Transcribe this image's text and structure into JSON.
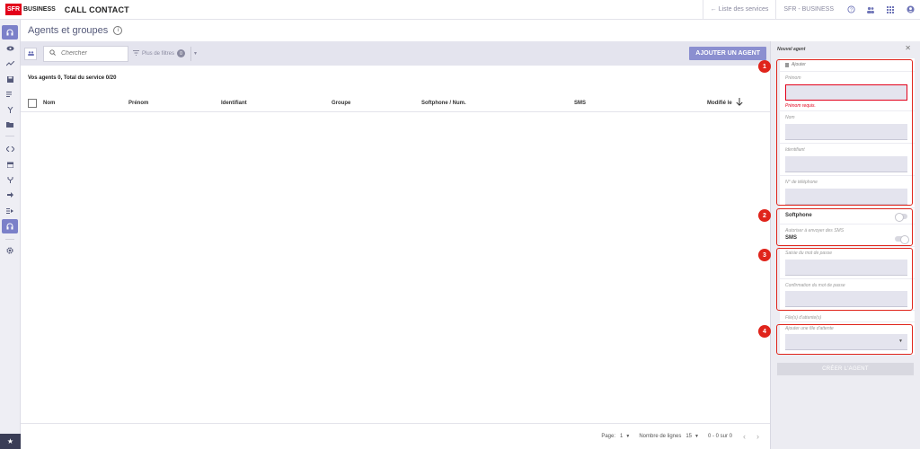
{
  "header": {
    "logo_sfr": "SFR",
    "logo_business": "BUSINESS",
    "app_title": "CALL CONTACT",
    "services_link": "← Liste des services",
    "account_label": "SFR - BUSINESS",
    "icons": [
      "help-icon",
      "users-icon",
      "apps-grid-icon",
      "account-icon"
    ]
  },
  "page": {
    "title": "Agents et groupes",
    "info_icon": "i"
  },
  "toolbar": {
    "search_placeholder": "Chercher",
    "filters_label": "Plus de filtres",
    "filters_count": "0",
    "add_agent_label": "AJOUTER UN AGENT"
  },
  "table": {
    "count_text": "Vos agents 0, Total du service 0/20",
    "columns": [
      "Nom",
      "Prénom",
      "Identifiant",
      "Groupe",
      "Softphone / Num.",
      "SMS",
      "Modifié le"
    ],
    "rows": []
  },
  "pagination": {
    "page_label": "Page:",
    "page_value": "1",
    "rows_label": "Nombre de lignes",
    "rows_value": "15",
    "range_text": "0 - 0 sur 0"
  },
  "panel": {
    "title": "Nouvel agent",
    "section_add": "Ajouter",
    "first_name_label": "Prénom",
    "first_name_error": "Prénom requis.",
    "last_name_label": "Nom",
    "identifier_label": "Identifiant",
    "phone_label": "N° de téléphone",
    "softphone_label": "Softphone",
    "sms_allow_label": "Autoriser à envoyer des SMS",
    "sms_label": "SMS",
    "password_label": "Saisie du mot de passe",
    "password_confirm_label": "Confirmation du mot de passe",
    "queues_label": "File(s) d'attente(s)",
    "add_queue_label": "Ajouter une file d'attente",
    "create_button": "CRÉER L'AGENT"
  },
  "annotations": [
    "1",
    "2",
    "3",
    "4"
  ],
  "colors": {
    "accent": "#7b80c9",
    "brand_red": "#e2001a",
    "annotation_red": "#e0241b",
    "toolbar_bg": "#e4e4ee",
    "rail_dark": "#3a3d56"
  }
}
